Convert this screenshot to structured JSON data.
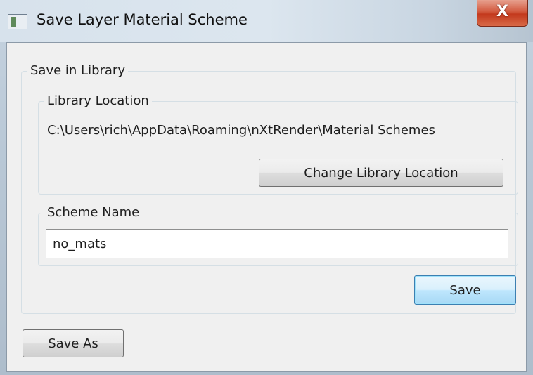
{
  "window": {
    "title": "Save Layer Material Scheme",
    "close_glyph": "X"
  },
  "save_in_library": {
    "label": "Save in Library",
    "library_location": {
      "label": "Library Location",
      "path": "C:\\Users\\rich\\AppData\\Roaming\\nXtRender\\Material Schemes",
      "change_button": "Change Library Location"
    },
    "scheme_name": {
      "label": "Scheme Name",
      "value": "no_mats"
    },
    "save_button": "Save"
  },
  "save_as_button": "Save As",
  "icons": {
    "app_icon": "window-app-icon",
    "close": "close-icon"
  },
  "colors": {
    "close_button": "#c3391d",
    "default_button_border": "#3c7fb1",
    "dialog_background": "#f0f0f0"
  }
}
